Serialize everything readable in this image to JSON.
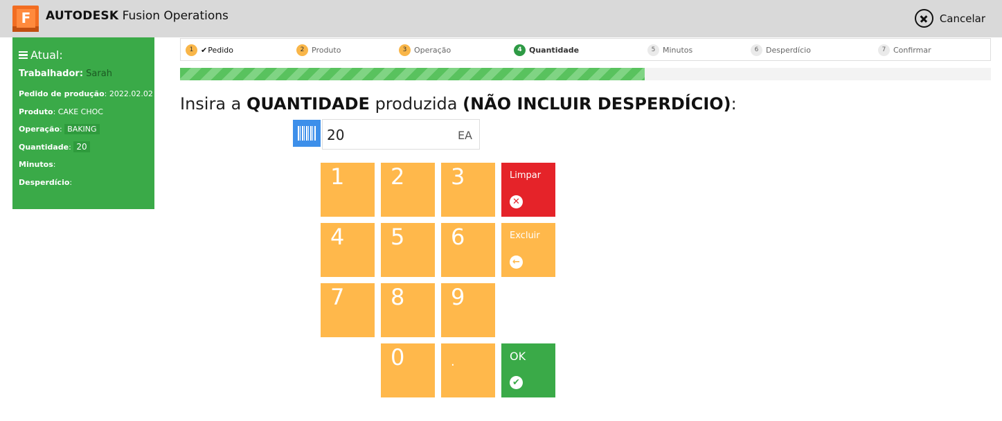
{
  "app": {
    "brand_bold": "AUTODESK",
    "brand_rest": " Fusion Operations",
    "logo_letter": "F",
    "cancel_label": "Cancelar"
  },
  "sidebar": {
    "heading": "Atual:",
    "rows": [
      {
        "label": "Trabalhador:",
        "value": "Sarah"
      },
      {
        "label": "Pedido de produção",
        "value": ": 2022.02.02"
      },
      {
        "label": "Produto",
        "value": ": CAKE CHOC"
      },
      {
        "label": "Operação",
        "value": "BAKING"
      },
      {
        "label": "Quantidade",
        "value": "20"
      },
      {
        "label": "Minutos",
        "value": ":"
      },
      {
        "label": "Desperdício",
        "value": ":"
      }
    ]
  },
  "steps": [
    {
      "num": "1",
      "label": "Pedido",
      "state": "done"
    },
    {
      "num": "2",
      "label": "Produto",
      "state": "done"
    },
    {
      "num": "3",
      "label": "Operação",
      "state": "done"
    },
    {
      "num": "4",
      "label": "Quantidade",
      "state": "active"
    },
    {
      "num": "5",
      "label": "Minutos",
      "state": "todo"
    },
    {
      "num": "6",
      "label": "Desperdício",
      "state": "todo"
    },
    {
      "num": "7",
      "label": "Confirmar",
      "state": "todo"
    }
  ],
  "progress": {
    "fraction": 0.573
  },
  "prompt": {
    "part1": "Insira a ",
    "part2": "QUANTIDADE",
    "part3": " produzida ",
    "part4": "(NÃO INCLUIR DESPERDÍCIO)",
    "part5": ":"
  },
  "input": {
    "value": "20",
    "unit": "EA"
  },
  "keypad": {
    "digits": [
      "1",
      "2",
      "3",
      "4",
      "5",
      "6",
      "7",
      "8",
      "9",
      "0",
      "."
    ],
    "clear_label": "Limpar",
    "delete_label": "Excluir",
    "ok_label": "OK"
  },
  "colors": {
    "accent_orange": "#ffb84b",
    "sidebar_green": "#3aaa48",
    "clear_red": "#e52329",
    "barcode_blue": "#3d8fea"
  }
}
